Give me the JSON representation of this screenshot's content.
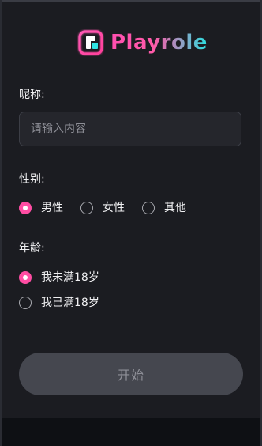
{
  "app": {
    "logo_text": "Playrole"
  },
  "form": {
    "nickname_label": "昵称:",
    "nickname_placeholder": "请输入内容",
    "nickname_value": "",
    "gender_label": "性别:",
    "gender_options": [
      {
        "label": "男性",
        "checked": true
      },
      {
        "label": "女性",
        "checked": false
      },
      {
        "label": "其他",
        "checked": false
      }
    ],
    "age_label": "年龄:",
    "age_options": [
      {
        "label": "我未满18岁",
        "checked": true
      },
      {
        "label": "我已满18岁",
        "checked": false
      }
    ],
    "start_label": "开始"
  },
  "colors": {
    "accent": "#ff4da3",
    "logo_gradient_start": "#ff4fb0",
    "logo_gradient_end": "#29e0e0",
    "panel": "#1b1c21",
    "button_disabled": "#45474f"
  },
  "icons": {
    "logo": "playrole-logo-icon"
  }
}
